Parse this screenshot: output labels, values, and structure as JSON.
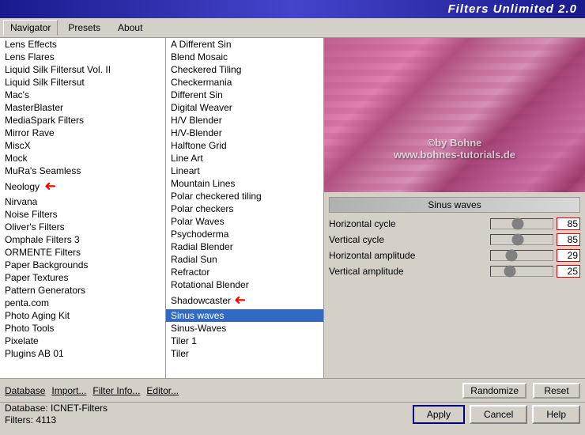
{
  "titleBar": {
    "text": "Filters Unlimited 2.0"
  },
  "menuBar": {
    "items": [
      "Navigator",
      "Presets",
      "About"
    ]
  },
  "leftPanel": {
    "items": [
      "Lens Effects",
      "Lens Flares",
      "Liquid Silk Filtersut Vol. II",
      "Liquid Silk Filtersut",
      "Mac's",
      "MasterBlaster",
      "MediaSpark Filters",
      "Mirror Rave",
      "MiscX",
      "Mock",
      "MuRa's Seamless",
      "Neology",
      "Nirvana",
      "Noise Filters",
      "Oliver's Filters",
      "Omphale Filters 3",
      "ORMENTE Filters",
      "Paper Backgrounds",
      "Paper Textures",
      "Pattern Generators",
      "penta.com",
      "Photo Aging Kit",
      "Photo Tools",
      "Pixelate",
      "Plugins AB 01"
    ]
  },
  "middlePanel": {
    "items": [
      "A Different Sin",
      "Blend Mosaic",
      "Checkered Tiling",
      "Checkermania",
      "Different Sin",
      "Digital Weaver",
      "H/V Blender",
      "H/V-Blender",
      "Halftone Grid",
      "Line Art",
      "Lineart",
      "Mountain Lines",
      "Polar checkered tiling",
      "Polar checkers",
      "Polar Waves",
      "Psychoderma",
      "Radial Blender",
      "Radial Sun",
      "Refractor",
      "Rotational Blender",
      "Shadowcaster",
      "Sinus waves",
      "Sinus-Waves",
      "Tiler 1",
      "Tiler"
    ],
    "selectedIndex": 21
  },
  "rightPanel": {
    "filterName": "Sinus waves",
    "watermarkLine1": "©by Bohne",
    "watermarkLine2": "www.bohnes-tutorials.de",
    "params": [
      {
        "label": "Horizontal cycle",
        "value": 85
      },
      {
        "label": "Vertical cycle",
        "value": 85
      },
      {
        "label": "Horizontal amplitude",
        "value": 29
      },
      {
        "label": "Vertical amplitude",
        "value": 25
      }
    ]
  },
  "bottomToolbar": {
    "links": [
      "Database",
      "Import...",
      "Filter Info...",
      "Editor..."
    ],
    "buttons": [
      "Randomize",
      "Reset"
    ]
  },
  "statusBar": {
    "database": "Database:  ICNET-Filters",
    "filters": "Filters:     4113"
  },
  "actionButtons": {
    "apply": "Apply",
    "cancel": "Cancel",
    "help": "Help"
  },
  "arrows": {
    "leftPanelArrow": "→",
    "middlePanelArrow": "→"
  }
}
